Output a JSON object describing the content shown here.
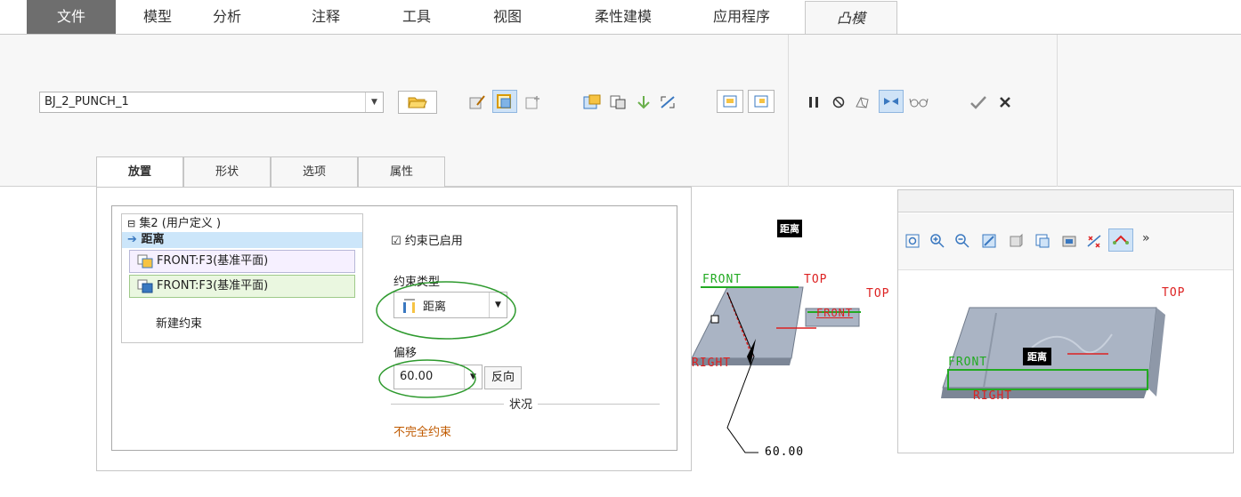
{
  "ribbon_tabs": [
    "文件",
    "模型",
    "分析",
    "注释",
    "工具",
    "视图",
    "柔性建模",
    "应用程序",
    "凸模"
  ],
  "part_select": {
    "value": "BJ_2_PUNCH_1"
  },
  "dashboard_tabs": [
    "放置",
    "形状",
    "选项",
    "属性"
  ],
  "placement": {
    "set_label": "集2 (用户定义 )",
    "constraint_item": "距离",
    "ref1": "FRONT:F3(基准平面)",
    "ref2": "FRONT:F3(基准平面)",
    "new_constraint": "新建约束",
    "enabled_label": "约束已启用",
    "constraint_type_label": "约束类型",
    "constraint_type_value": "距离",
    "offset_label": "偏移",
    "offset_value": "60.00",
    "flip_button": "反向",
    "status_label": "状况",
    "status_value": "不完全约束"
  },
  "viewport": {
    "dim_tag": "距离",
    "label_front": "FRONT",
    "label_top1": "TOP",
    "label_top2": "TOP",
    "label_front_small": "FRONT",
    "label_right": "RIGHT",
    "dim_value": "60.00"
  },
  "subwindow": {
    "more": "»",
    "label_top": "TOP",
    "label_front": "FRONT",
    "label_right": "RIGHT",
    "dim_tag": "距离"
  },
  "colors": {
    "accent_blue": "#cfe3f7",
    "datum_green": "#22aa22",
    "datum_red": "#dd2222",
    "status_orange": "#c05a00",
    "ellipse_green": "#2e9a2e"
  }
}
